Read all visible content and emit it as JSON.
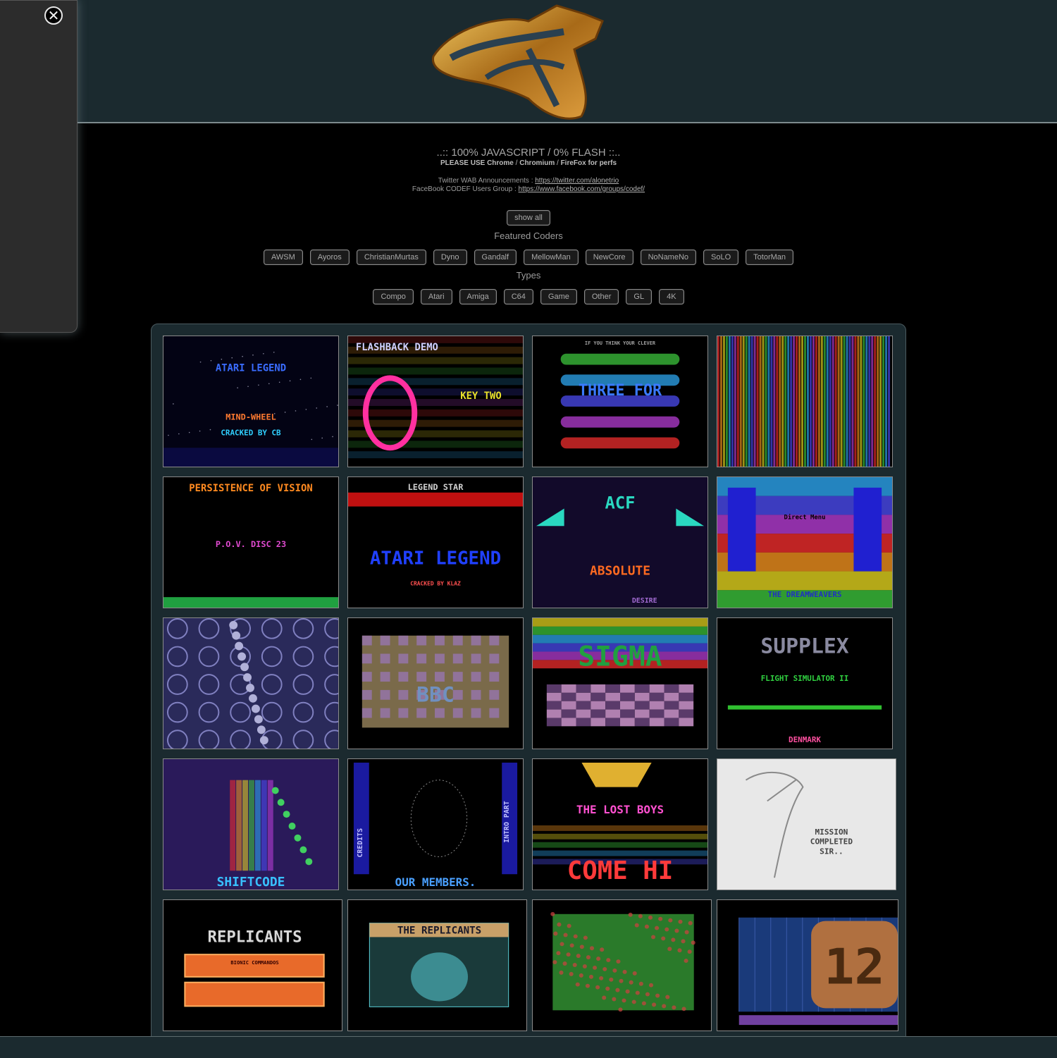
{
  "intro": {
    "headline": "..:: 100% JAVASCRIPT / 0% FLASH ::..",
    "please_prefix": "PLEASE USE Chrome",
    "please_sep1": " / ",
    "please_chromium": "Chromium",
    "please_sep2": " / ",
    "please_firefox": "FireFox for perfs",
    "twitter_label": "Twitter WAB Announcements : ",
    "twitter_url": "https://twitter.com/alonetrio",
    "facebook_label": "FaceBook CODEF Users Group : ",
    "facebook_url": "https://www.facebook.com/groups/codef/"
  },
  "show_all_label": "show all",
  "coders": {
    "heading": "Featured Coders",
    "items": [
      "AWSM",
      "Ayoros",
      "ChristianMurtas",
      "Dyno",
      "Gandalf",
      "MellowMan",
      "NewCore",
      "NoNameNo",
      "SoLO",
      "TotorMan"
    ]
  },
  "types": {
    "heading": "Types",
    "items": [
      "Compo",
      "Atari",
      "Amiga",
      "C64",
      "Game",
      "Other",
      "GL",
      "4K"
    ]
  },
  "side_panel": {
    "close_icon": "close-circle-icon"
  },
  "tiles": [
    {
      "name": "demo-thumb-atari-legend",
      "text1": "ATARI LEGEND",
      "text2": "MIND-WHEEL",
      "text3": "CRACKED BY CB",
      "accent": "#3a6cff"
    },
    {
      "name": "demo-thumb-flashback-demo",
      "text1": "FLASHBACK DEMO",
      "text2": "KEY TWO",
      "text3": "",
      "accent": "#e8e02a"
    },
    {
      "name": "demo-thumb-three-for-motion",
      "text1": "THREE FOR",
      "text2": "IF YOU THINK YOUR CLEVER",
      "text3": "",
      "accent": "#c84bd8"
    },
    {
      "name": "demo-thumb-vertical-bars",
      "text1": "",
      "text2": "",
      "text3": "",
      "accent": "#7ad3c8"
    },
    {
      "name": "demo-thumb-persistence-of-vision",
      "text1": "PERSISTENCE OF VISION",
      "text2": "P.O.V. DISC 23",
      "text3": "",
      "accent": "#ff8a20"
    },
    {
      "name": "demo-thumb-legend-star",
      "text1": "LEGEND STAR",
      "text2": "ATARI LEGEND",
      "text3": "CRACKED BY KLAZ",
      "accent": "#2040ff"
    },
    {
      "name": "demo-thumb-acf-absolute",
      "text1": "ACF",
      "text2": "ABSOLUTE",
      "text3": "DESIRE",
      "accent": "#2ad8c0"
    },
    {
      "name": "demo-thumb-dreamweavers",
      "text1": "THE DREAMWEAVERS",
      "text2": "Direct Menu",
      "text3": "",
      "accent": "#ff3a7a"
    },
    {
      "name": "demo-thumb-bubbles",
      "text1": "",
      "text2": "",
      "text3": "",
      "accent": "#6f6fb8"
    },
    {
      "name": "demo-thumb-bbc",
      "text1": "BBC",
      "text2": "",
      "text3": "",
      "accent": "#c8a050"
    },
    {
      "name": "demo-thumb-sigma",
      "text1": "SIGMA",
      "text2": "",
      "text3": "",
      "accent": "#e0d020"
    },
    {
      "name": "demo-thumb-supplex",
      "text1": "SUPPLEX",
      "text2": "FLIGHT SIMULATOR II",
      "text3": "DENMARK",
      "accent": "#ff40b0"
    },
    {
      "name": "demo-thumb-shiftcode",
      "text1": "SHIFTCODE",
      "text2": "",
      "text3": "",
      "accent": "#38c0ff"
    },
    {
      "name": "demo-thumb-our-members",
      "text1": "OUR MEMBERS.",
      "text2": "CREDITS",
      "text3": "INTRO PART",
      "accent": "#4aa0ff"
    },
    {
      "name": "demo-thumb-lost-boys",
      "text1": "THE LOST BOYS",
      "text2": "COME HI",
      "text3": "",
      "accent": "#ff3a3a"
    },
    {
      "name": "demo-thumb-mission-completed",
      "text1": "MISSION",
      "text2": "COMPLETED",
      "text3": "SIR..",
      "accent": "#8a8a8a"
    },
    {
      "name": "demo-thumb-replicants-bionic",
      "text1": "REPLICANTS",
      "text2": "BIONIC COMMANDOS",
      "text3": "",
      "accent": "#e86a2a"
    },
    {
      "name": "demo-thumb-the-replicants",
      "text1": "THE REPLICANTS",
      "text2": "",
      "text3": "",
      "accent": "#5ad0d8"
    },
    {
      "name": "demo-thumb-green-field",
      "text1": "",
      "text2": "",
      "text3": "",
      "accent": "#4ab040"
    },
    {
      "name": "demo-thumb-twelve",
      "text1": "12",
      "text2": "",
      "text3": "",
      "accent": "#b07040"
    }
  ]
}
